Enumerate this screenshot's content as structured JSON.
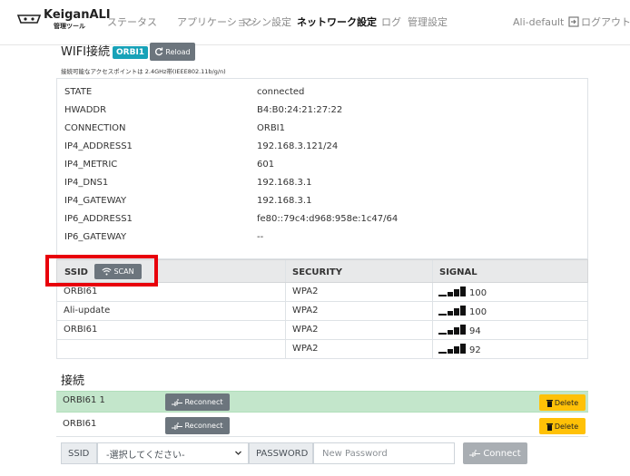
{
  "nav": {
    "brand": "KeiganALI",
    "brand_sub": "管理ツール",
    "links": [
      "ステータス",
      "アプリケーション",
      "マシン設定",
      "ネットワーク設定",
      "ログ",
      "管理設定"
    ],
    "active_index": 3,
    "user": "Ali-default",
    "logout": "ログアウト"
  },
  "wifi": {
    "title": "WIFI接続",
    "ssid_badge": "ORBI1",
    "reload_label": "Reload",
    "note": "接続可能なアクセスポイントは 2.4GHz帯(IEEE802.11b/g/n)",
    "status": [
      {
        "key": "STATE",
        "value": "connected"
      },
      {
        "key": "HWADDR",
        "value": "B4:B0:24:21:27:22"
      },
      {
        "key": "CONNECTION",
        "value": "ORBI1"
      },
      {
        "key": "IP4_ADDRESS1",
        "value": "192.168.3.121/24"
      },
      {
        "key": "IP4_METRIC",
        "value": "601"
      },
      {
        "key": "IP4_DNS1",
        "value": "192.168.3.1"
      },
      {
        "key": "IP4_GATEWAY",
        "value": "192.168.3.1"
      },
      {
        "key": "IP6_ADDRESS1",
        "value": "fe80::79c4:d968:958e:1c47/64"
      },
      {
        "key": "IP6_GATEWAY",
        "value": "--"
      }
    ]
  },
  "scan_table": {
    "headers": {
      "ssid": "SSID",
      "security": "SECURITY",
      "signal": "SIGNAL"
    },
    "scan_label": "SCAN",
    "rows": [
      {
        "ssid": "ORBI61",
        "security": "WPA2",
        "signal": "100"
      },
      {
        "ssid": "Ali-update",
        "security": "WPA2",
        "signal": "100"
      },
      {
        "ssid": "ORBI61",
        "security": "WPA2",
        "signal": "94"
      },
      {
        "ssid": "",
        "security": "WPA2",
        "signal": "92"
      }
    ]
  },
  "connections": {
    "title": "接続",
    "reconnect_label": "Reconnect",
    "delete_label": "Delete",
    "rows": [
      {
        "name": "ORBI61 1",
        "active": true
      },
      {
        "name": "ORBI61",
        "active": false
      }
    ]
  },
  "form": {
    "ssid_label": "SSID",
    "ssid_value": "-選択してください-",
    "password_label": "PASSWORD",
    "password_placeholder": "New Password",
    "connect_label": "Connect"
  },
  "colors": {
    "badge": "#17a2b8",
    "secondary": "#6c757d",
    "active_row": "#c3e6cb",
    "delete": "#ffc107",
    "highlight": "#e8000b"
  }
}
